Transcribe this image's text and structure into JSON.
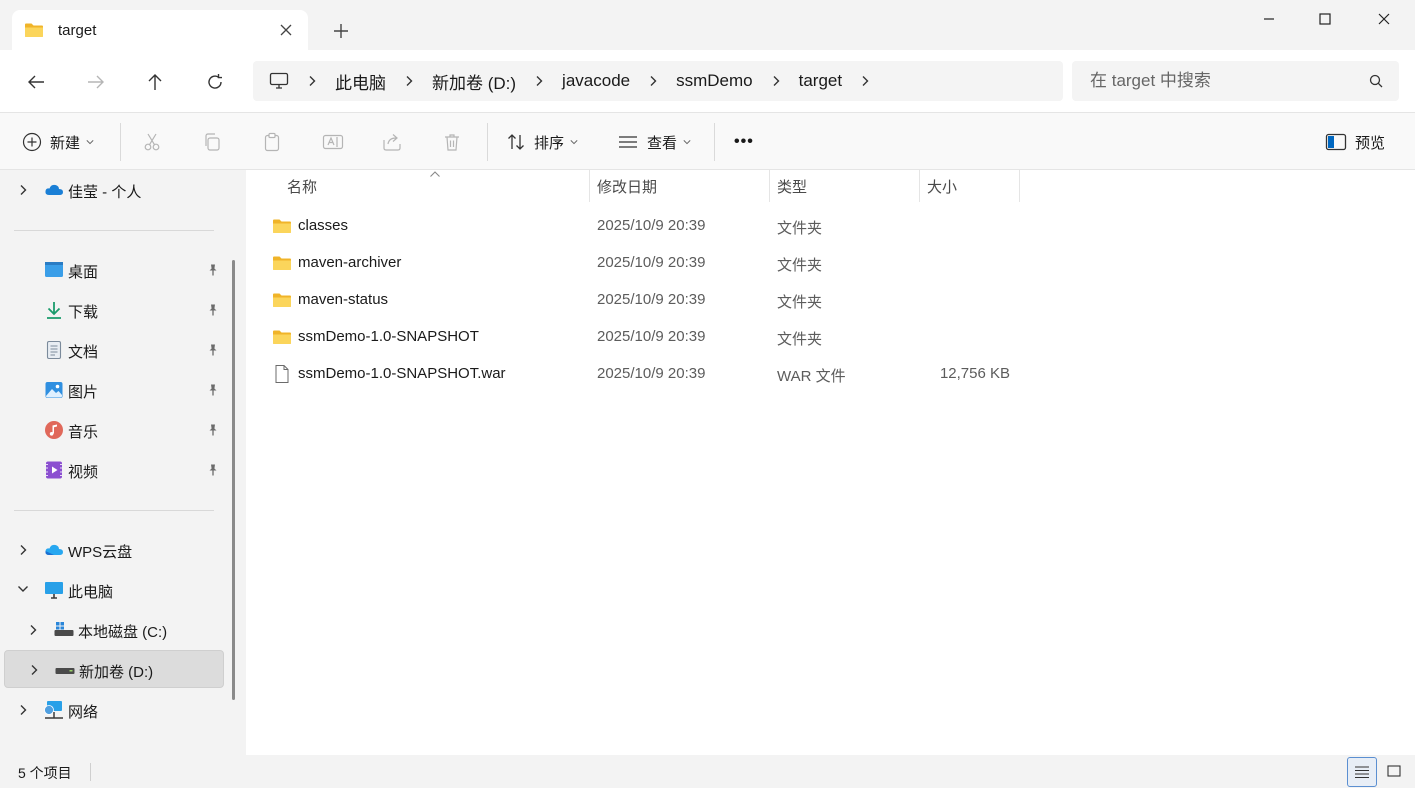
{
  "window": {
    "tab_title": "target",
    "icons": [
      "folder-icon",
      "close-icon",
      "plus-icon",
      "minimize-icon",
      "maximize-icon",
      "close-window-icon"
    ]
  },
  "nav": {
    "breadcrumb": [
      "此电脑",
      "新加卷 (D:)",
      "javacode",
      "ssmDemo",
      "target"
    ],
    "search_placeholder": "在 target 中搜索"
  },
  "toolbar": {
    "new_label": "新建",
    "sort_label": "排序",
    "view_label": "查看",
    "more_label": "•••",
    "preview_label": "预览"
  },
  "sidebar": {
    "onedrive": "佳莹 - 个人",
    "quick_access": [
      {
        "label": "桌面",
        "icon": "desktop-icon"
      },
      {
        "label": "下载",
        "icon": "download-icon"
      },
      {
        "label": "文档",
        "icon": "document-icon"
      },
      {
        "label": "图片",
        "icon": "pictures-icon"
      },
      {
        "label": "音乐",
        "icon": "music-icon"
      },
      {
        "label": "视频",
        "icon": "video-icon"
      }
    ],
    "wps": "WPS云盘",
    "this_pc": "此电脑",
    "drive_c": "本地磁盘 (C:)",
    "drive_d": "新加卷 (D:)",
    "network": "网络"
  },
  "columns": {
    "name": "名称",
    "date": "修改日期",
    "type": "类型",
    "size": "大小"
  },
  "files": [
    {
      "name": "classes",
      "date": "2025/10/9 20:39",
      "type": "文件夹",
      "size": "",
      "icon": "folder-icon"
    },
    {
      "name": "maven-archiver",
      "date": "2025/10/9 20:39",
      "type": "文件夹",
      "size": "",
      "icon": "folder-icon"
    },
    {
      "name": "maven-status",
      "date": "2025/10/9 20:39",
      "type": "文件夹",
      "size": "",
      "icon": "folder-icon"
    },
    {
      "name": "ssmDemo-1.0-SNAPSHOT",
      "date": "2025/10/9 20:39",
      "type": "文件夹",
      "size": "",
      "icon": "folder-icon"
    },
    {
      "name": "ssmDemo-1.0-SNAPSHOT.war",
      "date": "2025/10/9 20:39",
      "type": "WAR 文件",
      "size": "12,756 KB",
      "icon": "file-icon"
    }
  ],
  "status": {
    "count": "5 个项目"
  },
  "colors": {
    "folder": "#f8c846",
    "selected_bg": "#dcdcdc",
    "accent": "#0067c0"
  }
}
